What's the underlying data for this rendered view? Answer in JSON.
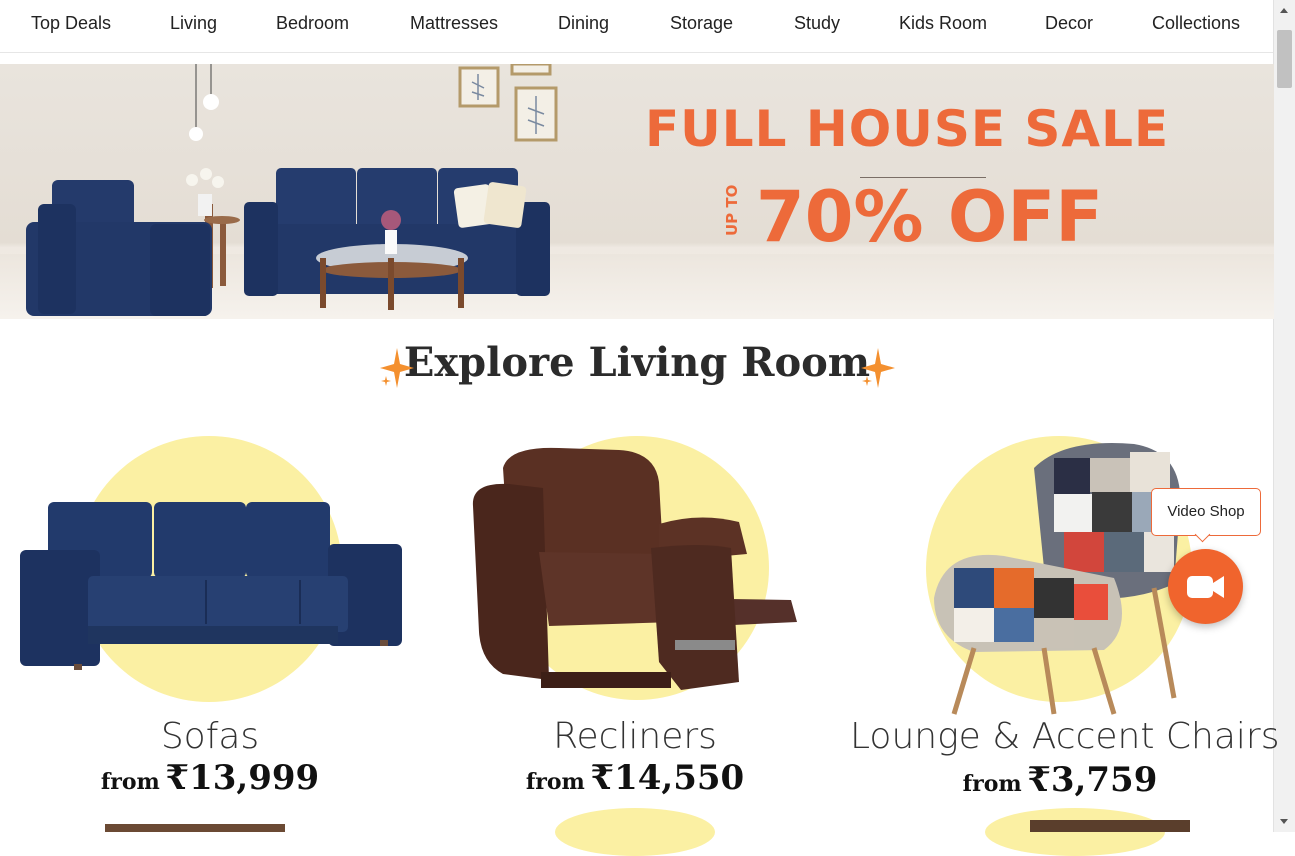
{
  "nav": {
    "items": [
      "Top Deals",
      "Living",
      "Bedroom",
      "Mattresses",
      "Dining",
      "Storage",
      "Study",
      "Kids Room",
      "Decor",
      "Collections"
    ]
  },
  "banner": {
    "title": "FULL HOUSE SALE",
    "upto": "UP TO",
    "discount": "70% OFF",
    "accent_color": "#ed6a3a"
  },
  "section": {
    "title": "Explore Living Room"
  },
  "categories": [
    {
      "label": "Sofas",
      "from": "from",
      "price": "₹13,999"
    },
    {
      "label": "Recliners",
      "from": "from",
      "price": "₹14,550"
    },
    {
      "label": "Lounge & Accent Chairs",
      "from": "from",
      "price": "₹3,759"
    }
  ],
  "video_shop": {
    "label": "Video Shop",
    "icon": "video-camera-icon",
    "button_color": "#f0642d"
  }
}
